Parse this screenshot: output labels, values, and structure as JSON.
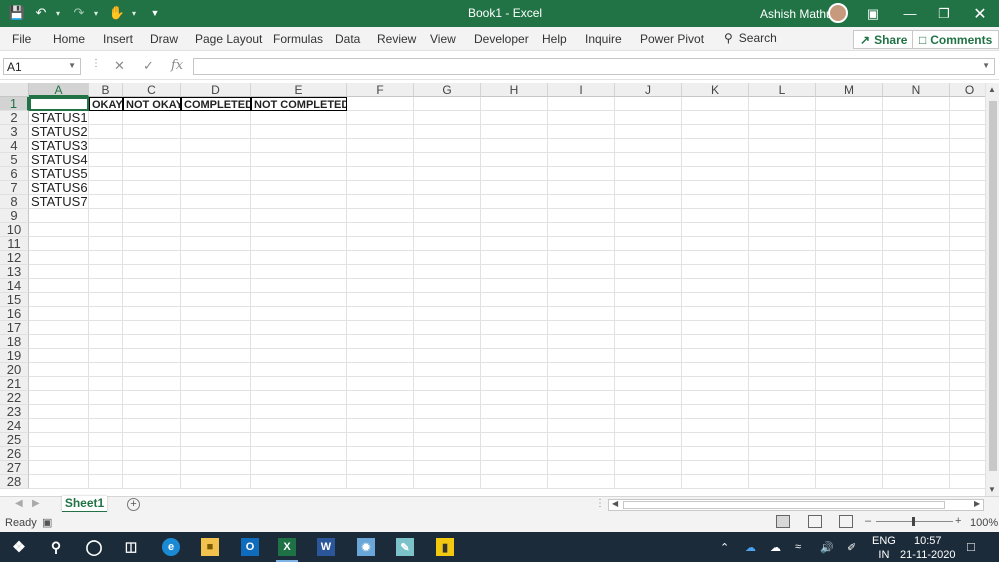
{
  "titlebar": {
    "doc_title": "Book1  -  Excel",
    "user_name": "Ashish Mathur",
    "bg_color": "#217346"
  },
  "ribbon": {
    "tabs": [
      "File",
      "Home",
      "Insert",
      "Draw",
      "Page Layout",
      "Formulas",
      "Data",
      "Review",
      "View",
      "Developer",
      "Help",
      "Inquire",
      "Power Pivot"
    ],
    "search_label": "Search",
    "share_label": "Share",
    "comments_label": "Comments"
  },
  "formula_bar": {
    "name_box": "A1",
    "formula": ""
  },
  "columns": [
    "A",
    "B",
    "C",
    "D",
    "E",
    "F",
    "G",
    "H",
    "I",
    "J",
    "K",
    "L",
    "M",
    "N",
    "O"
  ],
  "rows": [
    "1",
    "2",
    "3",
    "4",
    "5",
    "6",
    "7",
    "8",
    "9",
    "10",
    "11",
    "12",
    "13",
    "14",
    "15",
    "16",
    "17",
    "18",
    "19",
    "20",
    "21",
    "22",
    "23",
    "24",
    "25",
    "26",
    "27",
    "28"
  ],
  "cells": {
    "A1": "",
    "B1": "OKAY",
    "C1": "NOT OKAY",
    "D1": "COMPLETED",
    "E1": "NOT COMPLETED",
    "A2": "STATUS1",
    "A3": "STATUS2",
    "A4": "STATUS3",
    "A5": "STATUS4",
    "A6": "STATUS5",
    "A7": "STATUS6",
    "A8": "STATUS7"
  },
  "sheets": {
    "active": "Sheet1"
  },
  "status_bar": {
    "ready": "Ready",
    "zoom": "100%"
  },
  "taskbar": {
    "lang_line1": "ENG",
    "lang_line2": "IN",
    "time": "10:57",
    "date": "21-11-2020"
  }
}
